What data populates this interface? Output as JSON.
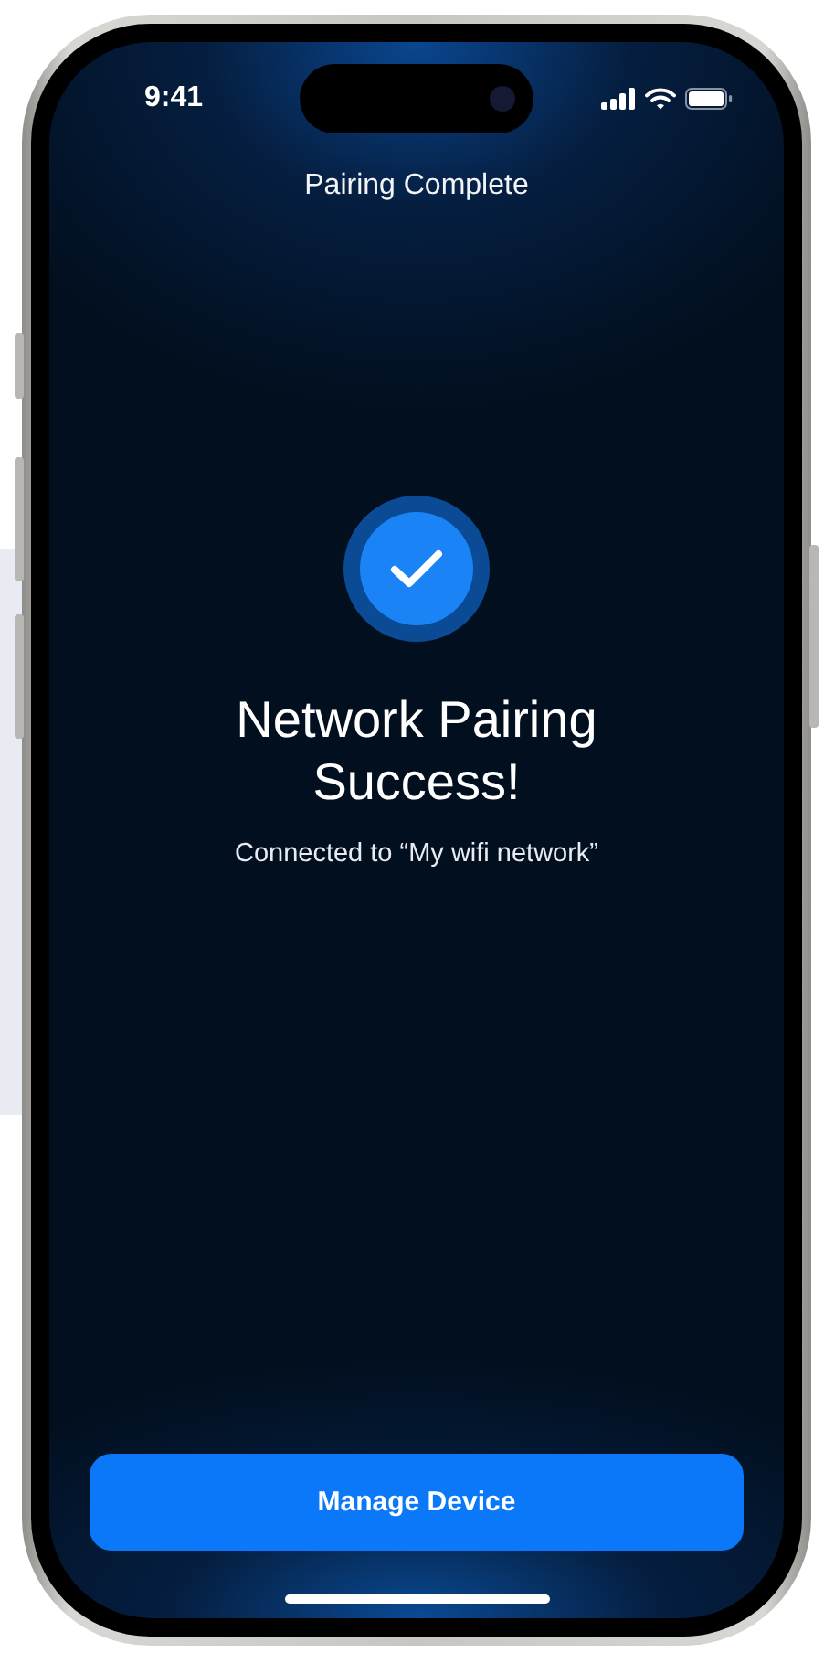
{
  "status_bar": {
    "time": "9:41"
  },
  "nav": {
    "title": "Pairing Complete"
  },
  "result": {
    "heading": "Network Pairing Success!",
    "message": "Connected to “My wifi network”"
  },
  "primary_button": {
    "label": "Manage Device"
  }
}
